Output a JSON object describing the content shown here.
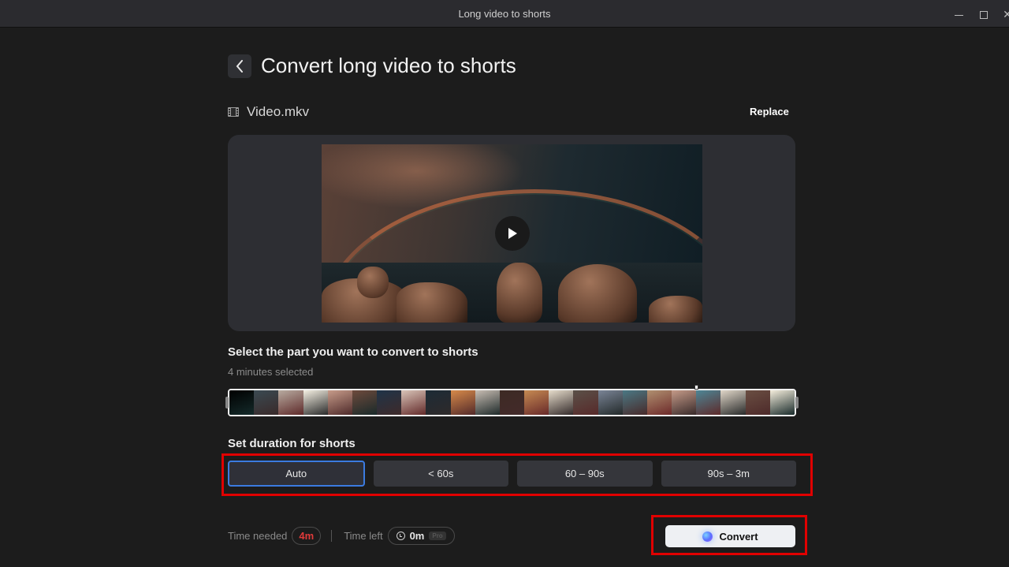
{
  "window": {
    "title": "Long video to shorts",
    "controls": [
      "minimize-icon",
      "maximize-icon",
      "close-icon"
    ]
  },
  "header": {
    "back_icon": "chevron-left-icon",
    "title": "Convert long video to shorts"
  },
  "file": {
    "icon": "film-icon",
    "name": "Video.mkv",
    "replace_label": "Replace"
  },
  "preview": {
    "play_icon": "play-icon"
  },
  "selection": {
    "title": "Select the part you want to convert to shorts",
    "subtitle": "4 minutes selected",
    "thumbnails": [
      "#000000",
      "#3b4a52",
      "#b8aba0",
      "#f4efe2",
      "#c79c8a",
      "#6e4a3c",
      "#1f3448",
      "#d9c4b8",
      "#1d2b36",
      "#d78a4a",
      "#c8bdb3",
      "#3d2a24",
      "#c68a52",
      "#e6dccb",
      "#5a5048",
      "#7a8496",
      "#4a7884",
      "#b09070",
      "#c59a88",
      "#4d8696",
      "#e0d6c8",
      "#6a4e42",
      "#f4eddc"
    ]
  },
  "duration": {
    "title": "Set duration for shorts",
    "options": [
      {
        "label": "Auto",
        "selected": true
      },
      {
        "label": "< 60s",
        "selected": false
      },
      {
        "label": "60 – 90s",
        "selected": false
      },
      {
        "label": "90s – 3m",
        "selected": false
      }
    ]
  },
  "footer": {
    "time_needed_label": "Time needed",
    "time_needed_value": "4m",
    "time_left_label": "Time left",
    "time_left_icon": "clock-icon",
    "time_left_value": "0m",
    "pro_badge": "Pro",
    "convert_label": "Convert",
    "convert_icon": "ai-orb-icon"
  },
  "colors": {
    "accent_selected": "#3b7be0",
    "time_needed": "#e03a3a",
    "highlight": "#e00000"
  }
}
